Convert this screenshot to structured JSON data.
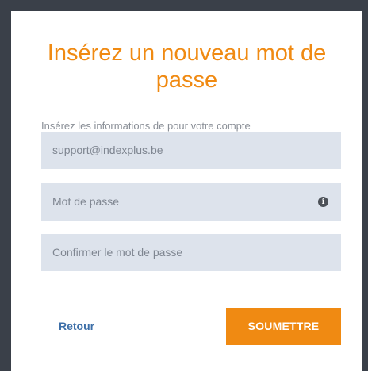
{
  "form": {
    "title_line1": "Insérez un nouveau mot de",
    "title_line2": "passe",
    "subtitle": "Insérez les informations de pour votre compte",
    "email_value": "support@indexplus.be",
    "password_placeholder": "Mot de passe",
    "password_info_icon": "info-circle-icon",
    "confirm_placeholder": "Confirmer le mot de passe",
    "back_label": "Retour",
    "submit_label": "SOUMETTRE"
  },
  "colors": {
    "accent": "#f08a12",
    "link": "#3d6fa8",
    "field_bg": "#dde3ec",
    "frame": "#3a4049"
  }
}
